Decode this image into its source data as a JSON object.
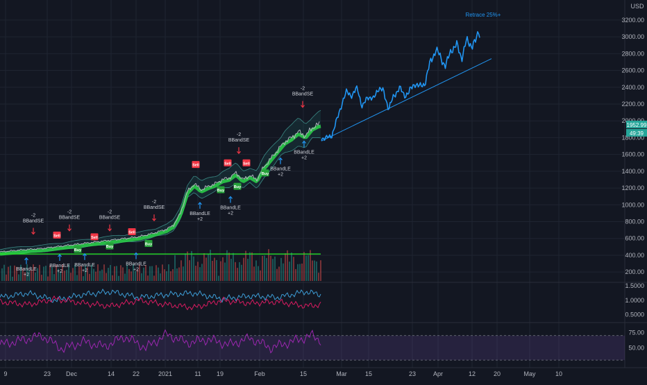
{
  "chart_data": [
    {
      "type": "line",
      "panel": "price",
      "yaxis": {
        "unit": "USD",
        "ticks": [
          200,
          400,
          600,
          800,
          1000,
          1200,
          1400,
          1600,
          1800,
          2000,
          2200,
          2400,
          2600,
          2800,
          3000,
          3200
        ],
        "tick_labels": [
          "200.00",
          "400.00",
          "600.00",
          "800.00",
          "1000.00",
          "1200.00",
          "1400.00",
          "1600.00",
          "1800.00",
          "2000.00",
          "2200.00",
          "2400.00",
          "2600.00",
          "2800.00",
          "3000.00",
          "3200.00"
        ],
        "ylim": [
          150,
          3380
        ],
        "price_label": "1952.99",
        "countdown_label": "49:39"
      },
      "xaxis": {
        "tick_labels": [
          "9",
          "23",
          "Dec",
          "14",
          "22",
          "2021",
          "11",
          "19",
          "Feb",
          "15",
          "Mar",
          "15",
          "23",
          "Apr",
          "12",
          "20",
          "May",
          "10"
        ]
      },
      "series": [
        {
          "role": "price-history",
          "color": "#b2b5be",
          "x": [
            0,
            20,
            40,
            60,
            80,
            100,
            120,
            140,
            160,
            180,
            200,
            220,
            240,
            250,
            260,
            270,
            280,
            290,
            300,
            310,
            320,
            330,
            340,
            350,
            360,
            370,
            380,
            390,
            400,
            410,
            420,
            430,
            440,
            450,
            460
          ],
          "values": [
            440,
            455,
            470,
            480,
            500,
            520,
            540,
            560,
            580,
            600,
            620,
            660,
            710,
            760,
            900,
            1160,
            1250,
            1180,
            1220,
            1250,
            1300,
            1320,
            1380,
            1300,
            1350,
            1300,
            1450,
            1550,
            1650,
            1750,
            1800,
            1870,
            1820,
            1920,
            1960
          ]
        },
        {
          "role": "projection",
          "color": "#2196f3",
          "x": [
            463,
            470,
            478,
            485,
            492,
            500,
            508,
            515,
            522,
            530,
            538,
            545,
            552,
            560,
            568,
            575,
            582,
            590,
            598,
            605,
            612,
            620,
            628,
            635,
            642,
            650,
            658,
            665,
            672,
            680,
            686,
            690,
            692
          ],
          "values": [
            1800,
            1790,
            1830,
            2000,
            2200,
            2350,
            2300,
            2400,
            2150,
            2300,
            2250,
            2400,
            2350,
            2150,
            2300,
            2400,
            2300,
            2350,
            2450,
            2400,
            2450,
            2700,
            2850,
            2750,
            2650,
            2850,
            2900,
            2750,
            2950,
            2900,
            2950,
            3100,
            2950
          ]
        }
      ],
      "trendline": {
        "x": [
          463,
          708
        ],
        "values": [
          1760,
          2740
        ],
        "color": "#2196f3"
      },
      "support_line": {
        "x": [
          0,
          462
        ],
        "values": [
          415,
          415
        ],
        "color": "#26e028"
      },
      "ribbon_color": "#2bd34a",
      "annotation": {
        "text": "Retrace 25%+",
        "x": 696,
        "value": 3240,
        "color": "#2196f3"
      },
      "signals": [
        {
          "type": "sell",
          "x": 48,
          "value": 660,
          "lines": [
            "-2",
            "BBandSE"
          ],
          "badge": ""
        },
        {
          "type": "sell",
          "x": 100,
          "value": 700,
          "lines": [
            "-2",
            "BBandSE"
          ],
          "badge": ""
        },
        {
          "type": "sell",
          "x": 158,
          "value": 700,
          "lines": [
            "-2",
            "BBandSE"
          ],
          "badge": ""
        },
        {
          "type": "sell",
          "x": 222,
          "value": 820,
          "lines": [
            "-2",
            "BBandSE"
          ],
          "badge": ""
        },
        {
          "type": "sell",
          "x": 344,
          "value": 1620,
          "lines": [
            "-2",
            "BBandSE"
          ],
          "badge": ""
        },
        {
          "type": "sell",
          "x": 436,
          "value": 2170,
          "lines": [
            "-2",
            "BBandSE"
          ],
          "badge": ""
        },
        {
          "type": "sell",
          "x": 82,
          "value": 640,
          "lines": [],
          "badge": "Sell"
        },
        {
          "type": "sell",
          "x": 136,
          "value": 620,
          "lines": [],
          "badge": "Sell"
        },
        {
          "type": "sell",
          "x": 190,
          "value": 680,
          "lines": [],
          "badge": "Sell"
        },
        {
          "type": "sell",
          "x": 282,
          "value": 1480,
          "lines": [],
          "badge": "Sell"
        },
        {
          "type": "sell",
          "x": 328,
          "value": 1500,
          "lines": [],
          "badge": "Sell"
        },
        {
          "type": "sell",
          "x": 355,
          "value": 1500,
          "lines": [],
          "badge": "Sell"
        },
        {
          "type": "buy",
          "x": 38,
          "value": 360,
          "lines": [
            "BBandLE",
            "+2"
          ],
          "badge": ""
        },
        {
          "type": "buy",
          "x": 86,
          "value": 400,
          "lines": [
            "BBandLE",
            "+2"
          ],
          "badge": ""
        },
        {
          "type": "buy",
          "x": 122,
          "value": 410,
          "lines": [
            "BBandLE",
            "+2"
          ],
          "badge": ""
        },
        {
          "type": "buy",
          "x": 196,
          "value": 420,
          "lines": [
            "BBandLE",
            "+2"
          ],
          "badge": ""
        },
        {
          "type": "buy",
          "x": 288,
          "value": 1020,
          "lines": [
            "BBandLE",
            "+2"
          ],
          "badge": ""
        },
        {
          "type": "buy",
          "x": 332,
          "value": 1090,
          "lines": [
            "BBandLE",
            "+2"
          ],
          "badge": ""
        },
        {
          "type": "buy",
          "x": 404,
          "value": 1550,
          "lines": [
            "BBandLE",
            "+2"
          ],
          "badge": ""
        },
        {
          "type": "buy",
          "x": 438,
          "value": 1750,
          "lines": [
            "BBandLE",
            "+2"
          ],
          "badge": ""
        },
        {
          "type": "buy",
          "x": 112,
          "value": 470,
          "lines": [],
          "badge": "Buy"
        },
        {
          "type": "buy",
          "x": 158,
          "value": 510,
          "lines": [],
          "badge": "Buy"
        },
        {
          "type": "buy",
          "x": 214,
          "value": 540,
          "lines": [],
          "badge": "Buy"
        },
        {
          "type": "buy",
          "x": 318,
          "value": 1180,
          "lines": [],
          "badge": "Buy"
        },
        {
          "type": "buy",
          "x": 342,
          "value": 1220,
          "lines": [],
          "badge": "Buy"
        },
        {
          "type": "buy",
          "x": 382,
          "value": 1380,
          "lines": [],
          "badge": "Buy"
        }
      ]
    },
    {
      "type": "line",
      "panel": "oscillator-1",
      "ylim": [
        0.3,
        1.6
      ],
      "ticks": [
        0.5,
        1.0,
        1.5
      ],
      "tick_labels": [
        "0.5000",
        "1.0000",
        "1.5000"
      ],
      "series": [
        {
          "color": "#3d9dd6",
          "x": [
            0,
            40,
            80,
            120,
            160,
            200,
            240,
            280,
            320,
            360,
            400,
            440,
            462
          ],
          "values": [
            1.1,
            1.25,
            1.0,
            1.2,
            1.3,
            1.1,
            1.2,
            1.25,
            1.05,
            1.15,
            1.1,
            1.3,
            1.2
          ]
        },
        {
          "color": "#d81b60",
          "x": [
            0,
            40,
            80,
            120,
            160,
            200,
            240,
            280,
            320,
            360,
            400,
            440,
            462
          ],
          "values": [
            0.95,
            0.85,
            1.05,
            0.9,
            0.8,
            1.0,
            0.85,
            0.75,
            1.0,
            0.9,
            0.95,
            0.8,
            0.85
          ]
        }
      ]
    },
    {
      "type": "line",
      "panel": "oscillator-2",
      "ylim": [
        20,
        90
      ],
      "ticks": [
        30,
        50,
        75
      ],
      "tick_labels": [
        "",
        "50.00",
        "75.00"
      ],
      "band": [
        30,
        70
      ],
      "series": [
        {
          "color": "#9c27b0",
          "x": [
            0,
            30,
            60,
            90,
            120,
            150,
            180,
            210,
            240,
            270,
            300,
            330,
            360,
            390,
            420,
            450,
            462
          ],
          "values": [
            55,
            62,
            70,
            48,
            60,
            52,
            68,
            50,
            72,
            58,
            64,
            55,
            66,
            50,
            60,
            70,
            62
          ]
        }
      ]
    }
  ]
}
